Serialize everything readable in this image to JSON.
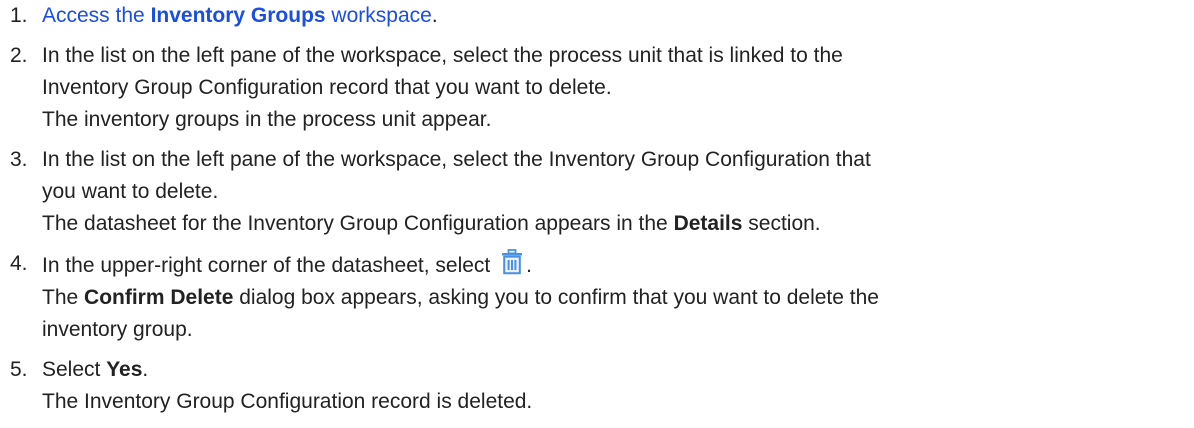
{
  "steps": [
    {
      "number": "1.",
      "prefix": "Access the ",
      "link_bold": "Inventory Groups",
      "link_rest": " workspace",
      "suffix": "."
    },
    {
      "number": "2.",
      "text_1": "In the list on the left pane of the workspace, select the process unit that is linked to the",
      "text_2": "Inventory Group Configuration record that you want to delete.",
      "result": "The inventory groups in the process unit appear."
    },
    {
      "number": "3.",
      "text_1": "In the list on the left pane of the workspace, select the Inventory Group Configuration that",
      "text_2": "you want to delete.",
      "result_prefix": "The datasheet for the Inventory Group Configuration appears in the ",
      "result_bold": "Details",
      "result_suffix": " section."
    },
    {
      "number": "4.",
      "text": "In the upper-right corner of the datasheet, select ",
      "icon": "trash-icon",
      "after_icon": ".",
      "result_prefix": "The ",
      "result_bold": "Confirm Delete",
      "result_suffix": " dialog box appears, asking you to confirm that you want to delete the",
      "result_2": "inventory group."
    },
    {
      "number": "5.",
      "prefix": "Select ",
      "bold": "Yes",
      "suffix": ".",
      "result": "The Inventory Group Configuration record is deleted."
    }
  ],
  "colors": {
    "link": "#1a4ee0",
    "text": "#222222",
    "icon": "#4a90e2"
  }
}
